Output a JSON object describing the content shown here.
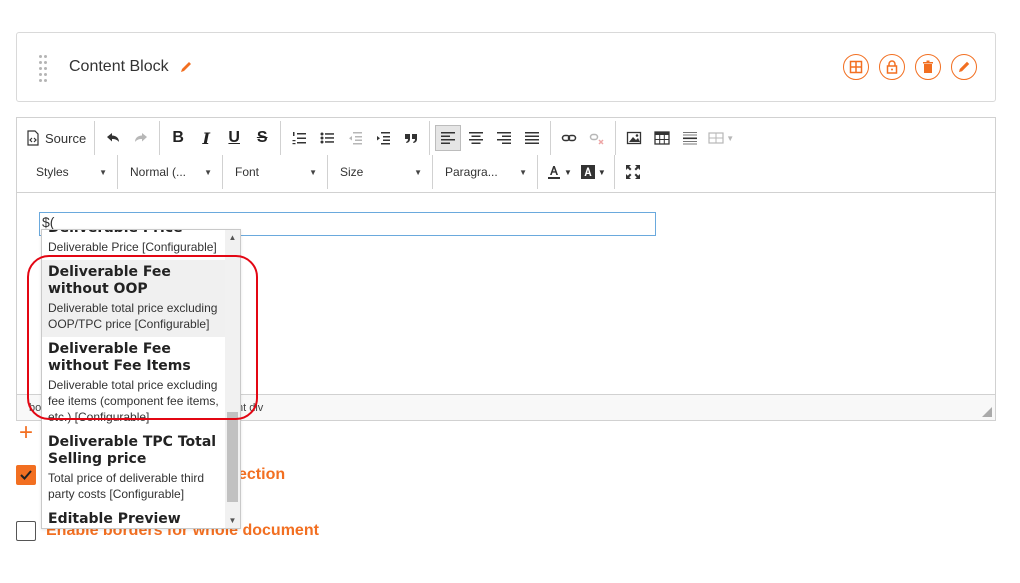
{
  "block": {
    "title": "Content Block",
    "icons": [
      "layout-icon",
      "lock-icon",
      "trash-icon",
      "pencil-icon"
    ]
  },
  "toolbar": {
    "source_label": "Source",
    "styles_label": "Styles",
    "format_label": "Normal (...",
    "font_label": "Font",
    "size_label": "Size",
    "paragraph_label": "Paragra..."
  },
  "editor": {
    "input_value": "$(",
    "path_start": "bo",
    "path_end": "nt  div"
  },
  "autocomplete": {
    "items": [
      {
        "name": "Deliverable Price",
        "desc": "Deliverable Price [Configurable]",
        "highlighted": false
      },
      {
        "name": "Deliverable Fee without OOP",
        "desc": "Deliverable total price excluding OOP/TPC price [Configurable]",
        "highlighted": true
      },
      {
        "name": "Deliverable Fee without Fee Items",
        "desc": "Deliverable total price excluding fee items (component fee items, etc.) [Configurable]",
        "highlighted": false
      },
      {
        "name": "Deliverable TPC Total Selling price",
        "desc": "Total price of deliverable third party costs [Configurable]",
        "highlighted": false
      },
      {
        "name": "Editable Preview Data",
        "desc": "",
        "highlighted": false
      }
    ]
  },
  "options": {
    "add_symbol": "+",
    "section_label_tail": "ection",
    "borders_label": "Enable borders for whole document",
    "section_checked": true,
    "borders_checked": false
  },
  "colors": {
    "accent": "#f26f21",
    "annotation": "#e30613",
    "input_focus": "#6aa9dd"
  }
}
